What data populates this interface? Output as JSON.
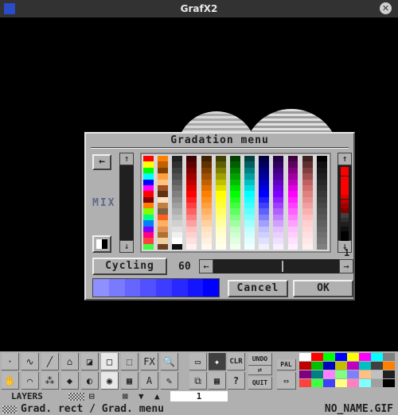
{
  "window": {
    "title": "GrafX2",
    "close_glyph": "✕"
  },
  "dialog": {
    "title": "Gradation menu",
    "left_arrow": "←",
    "mix_label": "MIX",
    "up_arrow": "↑",
    "down_arrow": "↓",
    "page_number": "1",
    "cycling_label": "Cycling",
    "speed_value": "60",
    "scroll_left": "←",
    "scroll_right": "→",
    "cancel_label": "Cancel",
    "ok_label": "OK",
    "preview_colors": [
      "#8f8fff",
      "#7a7aff",
      "#6666ff",
      "#5151ff",
      "#3d3dff",
      "#2828ff",
      "#1414ff",
      "#0000ff"
    ]
  },
  "palette_columns": [
    [
      "#ff0000",
      "#ffff00",
      "#00ff00",
      "#00ffff",
      "#0000ff",
      "#ff00ff",
      "#ff0000",
      "#800000",
      "#ff8000",
      "#80ff00",
      "#00ff80",
      "#0080ff",
      "#8000ff",
      "#ff0080",
      "#ff4040",
      "#40ff40"
    ],
    [
      "#ff8000",
      "#c06000",
      "#804000",
      "#ffa040",
      "#ffc080",
      "#a05020",
      "#603010",
      "#ffe0c0",
      "#c08040",
      "#806040",
      "#ff6020",
      "#ffb060",
      "#e09050",
      "#b07030",
      "#f0d0a0",
      "#704020"
    ],
    [
      "#202020",
      "#303030",
      "#404040",
      "#505050",
      "#606060",
      "#707070",
      "#808080",
      "#909090",
      "#a0a0a0",
      "#b0b0b0",
      "#c0c0c0",
      "#d0d0d0",
      "#e0e0e0",
      "#f0f0f0",
      "#ffffff",
      "#101010"
    ],
    [
      "#400000",
      "#600000",
      "#800000",
      "#a00000",
      "#c00000",
      "#e00000",
      "#ff0000",
      "#ff2020",
      "#ff4040",
      "#ff6060",
      "#ff8080",
      "#ffa0a0",
      "#ffc0c0",
      "#ffd0d0",
      "#ffe0e0",
      "#fff0f0"
    ],
    [
      "#402000",
      "#603000",
      "#804000",
      "#a05000",
      "#c06000",
      "#e07000",
      "#ff8000",
      "#ff9020",
      "#ffa040",
      "#ffb060",
      "#ffc080",
      "#ffd0a0",
      "#ffe0c0",
      "#ffe8d0",
      "#fff0e0",
      "#fff8f0"
    ],
    [
      "#404000",
      "#606000",
      "#808000",
      "#a0a000",
      "#c0c000",
      "#e0e000",
      "#ffff00",
      "#ffff20",
      "#ffff40",
      "#ffff60",
      "#ffff80",
      "#ffffa0",
      "#ffffc0",
      "#ffffd0",
      "#ffffe0",
      "#fffff0"
    ],
    [
      "#004000",
      "#006000",
      "#008000",
      "#00a000",
      "#00c000",
      "#00e000",
      "#00ff00",
      "#20ff20",
      "#40ff40",
      "#60ff60",
      "#80ff80",
      "#a0ffa0",
      "#c0ffc0",
      "#d0ffd0",
      "#e0ffe0",
      "#f0fff0"
    ],
    [
      "#004040",
      "#006060",
      "#008080",
      "#00a0a0",
      "#00c0c0",
      "#00e0e0",
      "#00ffff",
      "#20ffff",
      "#40ffff",
      "#60ffff",
      "#80ffff",
      "#a0ffff",
      "#c0ffff",
      "#d0ffff",
      "#e0ffff",
      "#f0ffff"
    ],
    [
      "#000040",
      "#000060",
      "#000080",
      "#0000a0",
      "#0000c0",
      "#0000e0",
      "#0000ff",
      "#2020ff",
      "#4040ff",
      "#6060ff",
      "#8080ff",
      "#a0a0ff",
      "#c0c0ff",
      "#d0d0ff",
      "#e0e0ff",
      "#f0f0ff"
    ],
    [
      "#200040",
      "#300060",
      "#400080",
      "#5000a0",
      "#6000c0",
      "#7000e0",
      "#8000ff",
      "#9020ff",
      "#a040ff",
      "#b060ff",
      "#c080ff",
      "#d0a0ff",
      "#e0c0ff",
      "#e8d0ff",
      "#f0e0ff",
      "#f8f0ff"
    ],
    [
      "#400040",
      "#600060",
      "#800080",
      "#a000a0",
      "#c000c0",
      "#e000e0",
      "#ff00ff",
      "#ff20ff",
      "#ff40ff",
      "#ff60ff",
      "#ff80ff",
      "#ffa0ff",
      "#ffc0ff",
      "#ffd0ff",
      "#ffe0ff",
      "#fff0ff"
    ],
    [
      "#402020",
      "#603030",
      "#804040",
      "#a05050",
      "#c06060",
      "#d07070",
      "#e08080",
      "#e89090",
      "#f0a0a0",
      "#f8b0b0",
      "#ffc0c0",
      "#ffd0d0",
      "#ffd8d8",
      "#ffe0e0",
      "#ffe8e8",
      "#fff0f0"
    ],
    [
      "#000000",
      "#101010",
      "#181818",
      "#202020",
      "#282828",
      "#303030",
      "#383838",
      "#404040",
      "#484848",
      "#505050",
      "#585858",
      "#606060",
      "#686868",
      "#707070",
      "#787878",
      "#808080"
    ]
  ],
  "gradient_column": [
    "#ff0000",
    "#ff0000",
    "#ff0000",
    "#ff0000",
    "#ff0000",
    "#ff0000",
    "#e00000",
    "#c00000",
    "#a00000",
    "#800000",
    "#404040",
    "#303030",
    "#202020",
    "#101010",
    "#000000",
    "#000000"
  ],
  "toolbar": {
    "tools_row1": [
      "·",
      "∿",
      "╱",
      "⌂",
      "◪",
      "□",
      "⬚",
      "FX",
      "🔍"
    ],
    "tools_row2": [
      "✋",
      "⌒",
      "⁂",
      "◆",
      "◐",
      "◉",
      "▦",
      "A",
      "✎"
    ],
    "clr_label": "CLR",
    "undo_label": "UNDO",
    "quit_label": "QUIT",
    "pal_label": "PAL",
    "question": "?",
    "layers_label": "LAYERS",
    "layer_number": "1"
  },
  "status": {
    "message": "Grad. rect / Grad. menu",
    "filename": "NO_NAME.GIF"
  },
  "small_palette": [
    "#ffffff",
    "#ff0000",
    "#00ff00",
    "#0000ff",
    "#ffff00",
    "#ff00ff",
    "#00ffff",
    "#808080",
    "#c00000",
    "#00c000",
    "#0000c0",
    "#c0c000",
    "#c000c0",
    "#00c0c0",
    "#404040",
    "#ff8000",
    "#800080",
    "#008080",
    "#ff80ff",
    "#80ff80",
    "#8080ff",
    "#ffc080",
    "#c0c0c0",
    "#202020",
    "#ff4040",
    "#40ff40",
    "#4040ff",
    "#ffff80",
    "#ff80c0",
    "#80ffff",
    "#a0a0a0",
    "#000000"
  ]
}
